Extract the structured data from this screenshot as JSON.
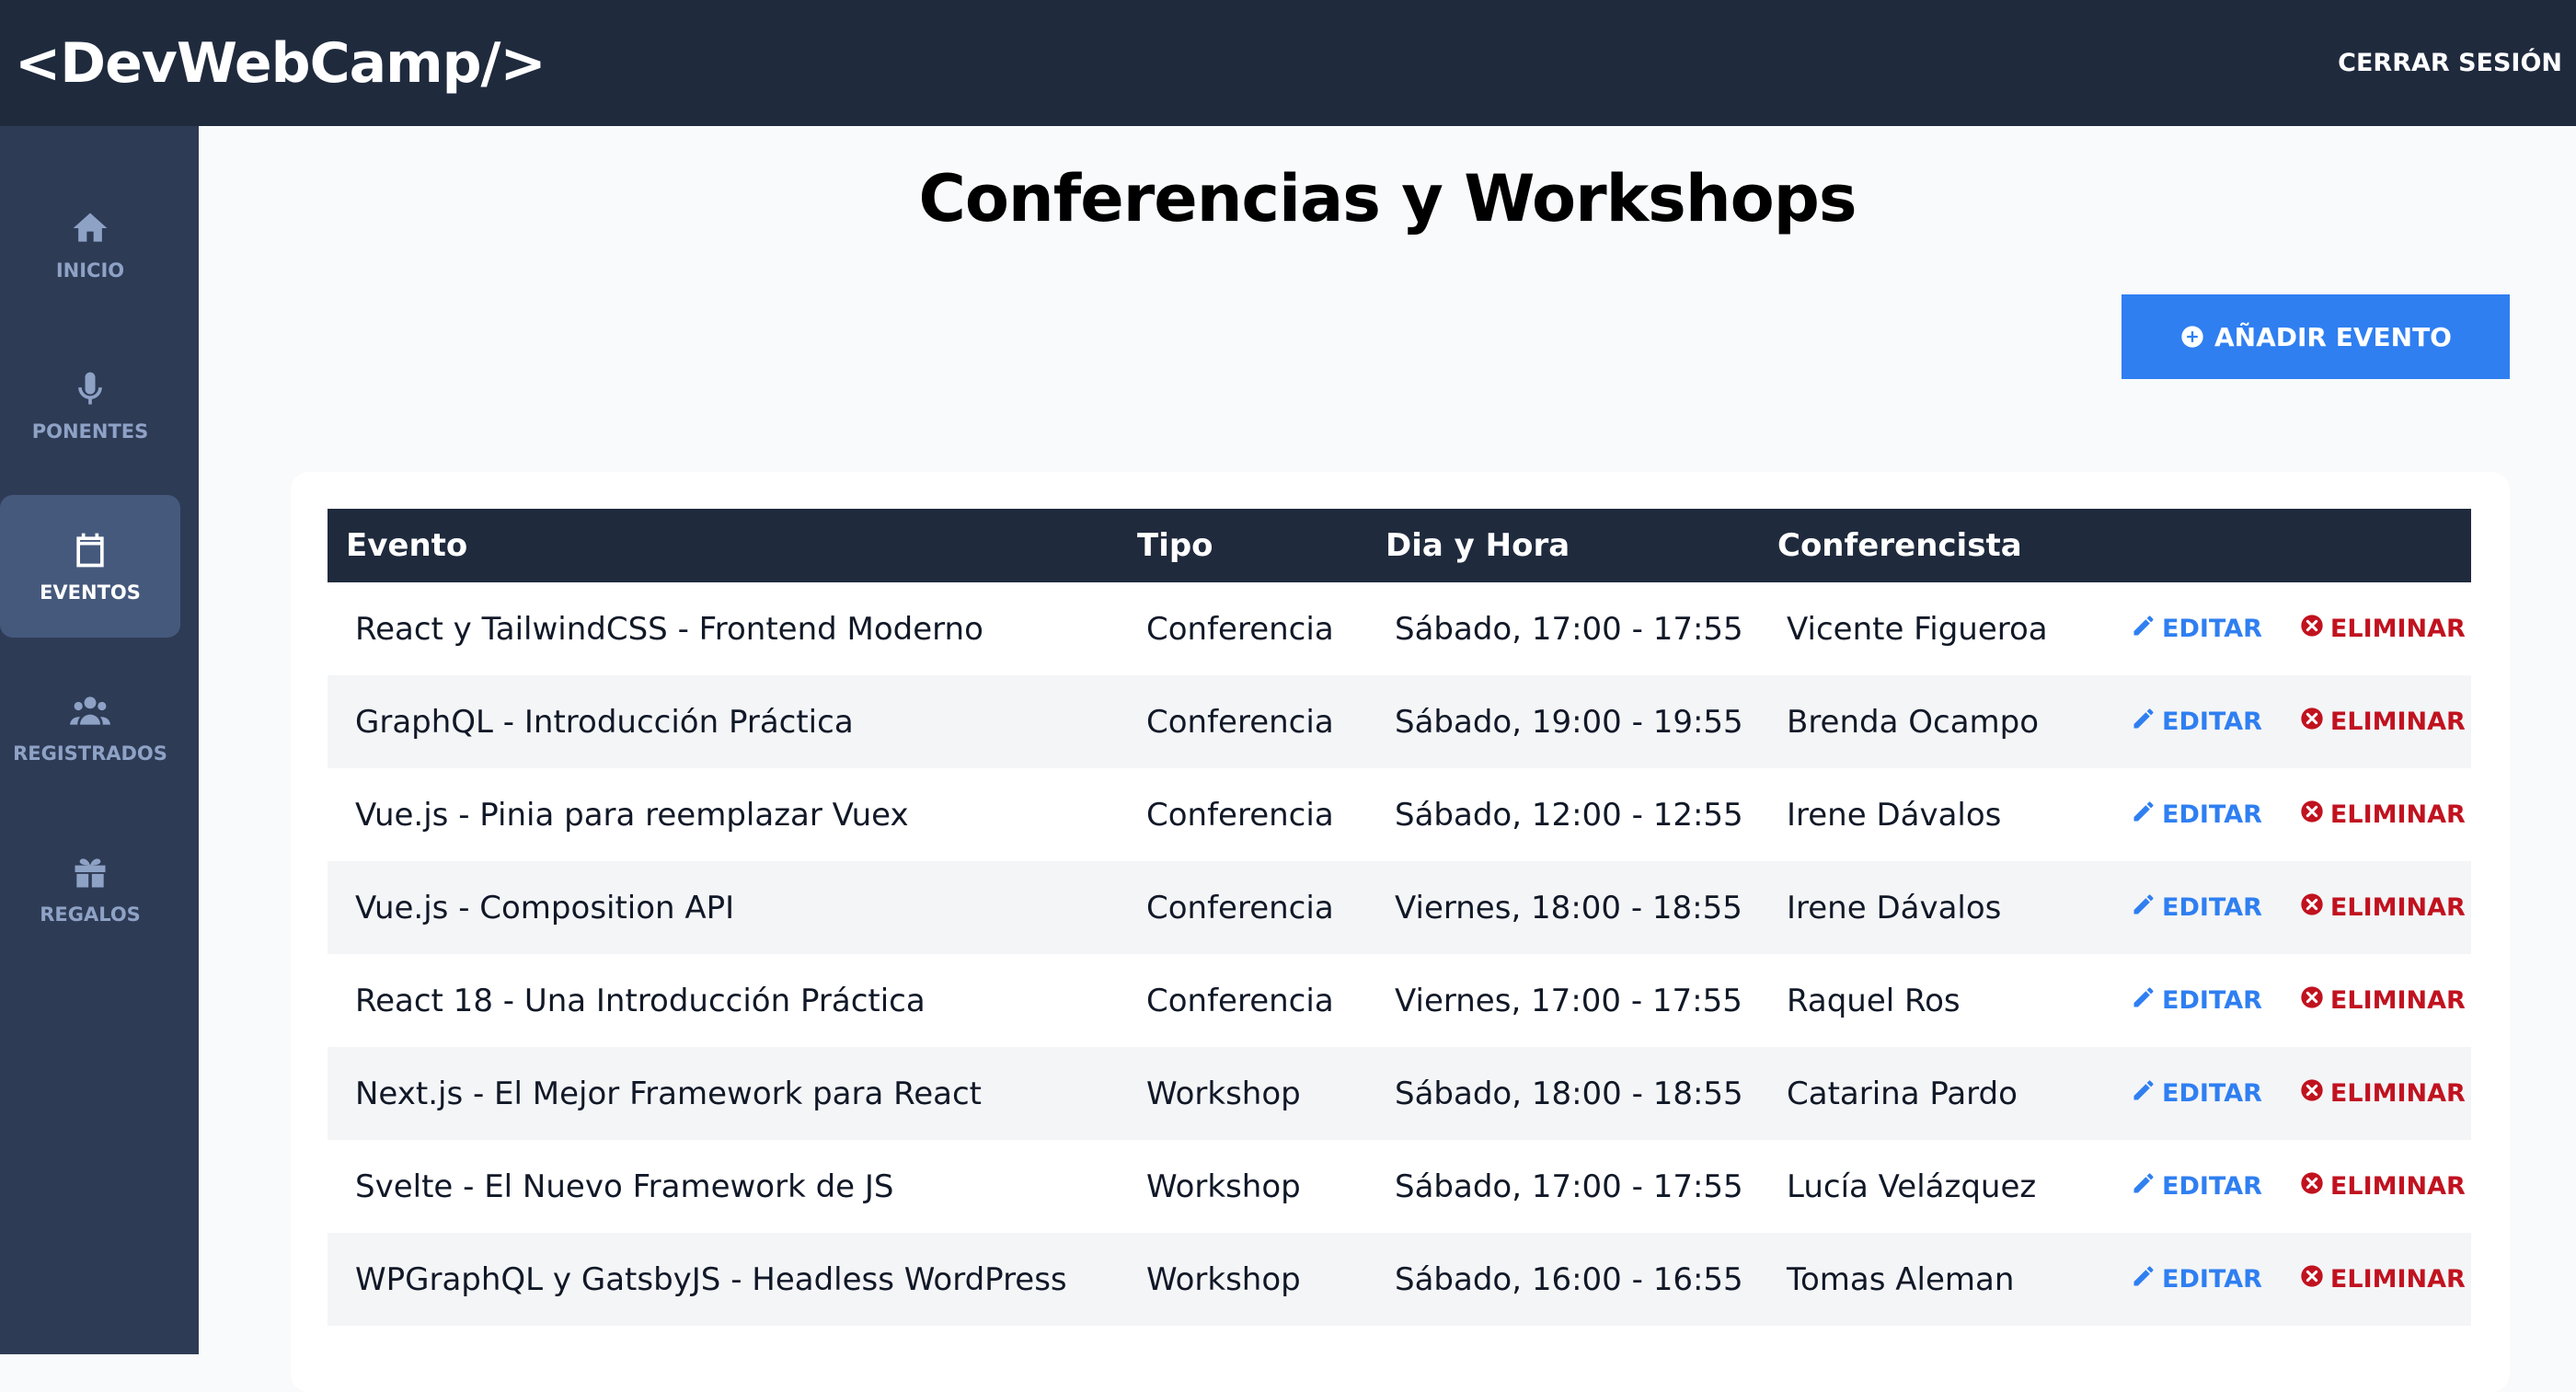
{
  "header": {
    "logo": "<DevWebCamp/>",
    "logout_label": "CERRAR SESIÓN"
  },
  "sidebar": {
    "items": [
      {
        "label": "INICIO",
        "icon": "home-icon",
        "active": false
      },
      {
        "label": "PONENTES",
        "icon": "microphone-icon",
        "active": false
      },
      {
        "label": "EVENTOS",
        "icon": "calendar-icon",
        "active": true
      },
      {
        "label": "REGISTRADOS",
        "icon": "users-icon",
        "active": false
      },
      {
        "label": "REGALOS",
        "icon": "gift-icon",
        "active": false
      }
    ]
  },
  "main": {
    "title": "Conferencias y Workshops",
    "add_button_label": "AÑADIR EVENTO"
  },
  "table": {
    "columns": [
      "Evento",
      "Tipo",
      "Dia y Hora",
      "Conferencista"
    ],
    "edit_label": "EDITAR",
    "delete_label": "ELIMINAR",
    "rows": [
      {
        "evento": "React y TailwindCSS - Frontend Moderno",
        "tipo": "Conferencia",
        "dia_hora": "Sábado, 17:00 - 17:55",
        "conferencista": "Vicente Figueroa"
      },
      {
        "evento": "GraphQL - Introducción Práctica",
        "tipo": "Conferencia",
        "dia_hora": "Sábado, 19:00 - 19:55",
        "conferencista": "Brenda Ocampo"
      },
      {
        "evento": "Vue.js - Pinia para reemplazar Vuex",
        "tipo": "Conferencia",
        "dia_hora": "Sábado, 12:00 - 12:55",
        "conferencista": "Irene Dávalos"
      },
      {
        "evento": "Vue.js - Composition API",
        "tipo": "Conferencia",
        "dia_hora": "Viernes, 18:00 - 18:55",
        "conferencista": "Irene Dávalos"
      },
      {
        "evento": "React 18 - Una Introducción Práctica",
        "tipo": "Conferencia",
        "dia_hora": "Viernes, 17:00 - 17:55",
        "conferencista": "Raquel Ros"
      },
      {
        "evento": "Next.js - El Mejor Framework para React",
        "tipo": "Workshop",
        "dia_hora": "Sábado, 18:00 - 18:55",
        "conferencista": "Catarina Pardo"
      },
      {
        "evento": "Svelte - El Nuevo Framework de JS",
        "tipo": "Workshop",
        "dia_hora": "Sábado, 17:00 - 17:55",
        "conferencista": "Lucía Velázquez"
      },
      {
        "evento": "WPGraphQL y GatsbyJS - Headless WordPress",
        "tipo": "Workshop",
        "dia_hora": "Sábado, 16:00 - 16:55",
        "conferencista": "Tomas Aleman"
      }
    ]
  },
  "colors": {
    "header_bg": "#1f2a3d",
    "sidebar_bg": "#2e3b55",
    "accent_blue": "#2f7ff1",
    "danger_red": "#c1121f"
  }
}
